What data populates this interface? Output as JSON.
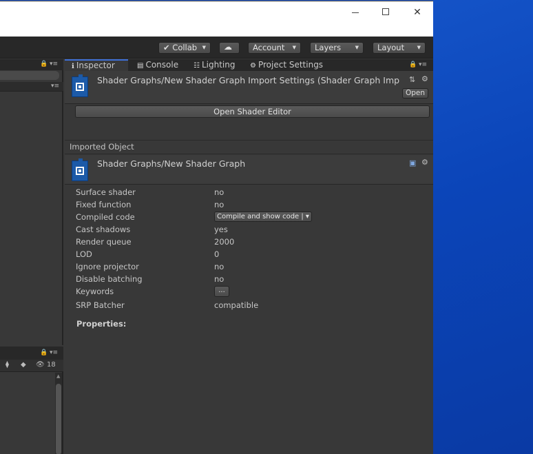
{
  "window": {
    "controls": {
      "minimize": "—",
      "maximize": "☐",
      "close": "✕"
    }
  },
  "toolbar": {
    "collab": "Collab",
    "cloud_icon": "cloud-icon",
    "account": "Account",
    "layers": "Layers",
    "layout": "Layout"
  },
  "left_bottom": {
    "hidden_count": "18"
  },
  "tabs": [
    {
      "label": "Inspector",
      "icon": "info-icon",
      "active": true
    },
    {
      "label": "Console",
      "icon": "console-icon",
      "active": false
    },
    {
      "label": "Lighting",
      "icon": "lighting-icon",
      "active": false
    },
    {
      "label": "Project Settings",
      "icon": "gear-icon",
      "active": false
    }
  ],
  "asset": {
    "title": "Shader Graphs/New Shader Graph Import Settings (Shader Graph Imp",
    "open_label": "Open",
    "open_editor_label": "Open Shader Editor"
  },
  "imported": {
    "section_label": "Imported Object",
    "title": "Shader Graphs/New Shader Graph"
  },
  "properties": [
    {
      "label": "Surface shader",
      "value": "no"
    },
    {
      "label": "Fixed function",
      "value": "no"
    },
    {
      "label": "Compiled code",
      "value": "Compile and show code | ▾"
    },
    {
      "label": "Cast shadows",
      "value": "yes"
    },
    {
      "label": "Render queue",
      "value": "2000"
    },
    {
      "label": "LOD",
      "value": "0"
    },
    {
      "label": "Ignore projector",
      "value": "no"
    },
    {
      "label": "Disable batching",
      "value": "no"
    },
    {
      "label": "Keywords",
      "value": "..."
    },
    {
      "label": "SRP Batcher",
      "value": "compatible"
    }
  ],
  "properties_heading": "Properties:",
  "colors": {
    "accent": "#3c6fd6",
    "panel": "#383838",
    "desktop": "#0b45b9"
  }
}
